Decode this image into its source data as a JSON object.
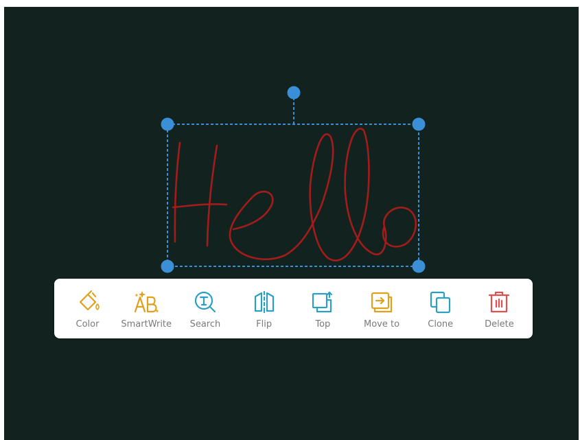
{
  "canvas": {
    "background": "#12231f",
    "ink_color": "#a31b1b",
    "selection_color": "#3a8fd6",
    "handwriting_text": "Hello"
  },
  "toolbar": {
    "items": [
      {
        "label": "Color",
        "icon": "paint-bucket-icon",
        "color": "#e0a01a"
      },
      {
        "label": "SmartWrite",
        "icon": "smartwrite-ab-icon",
        "color": "#e0a01a"
      },
      {
        "label": "Search",
        "icon": "text-search-icon",
        "color": "#2a9fc2"
      },
      {
        "label": "Flip",
        "icon": "flip-icon",
        "color": "#2a9fc2"
      },
      {
        "label": "Top",
        "icon": "bring-to-top-icon",
        "color": "#2a9fc2"
      },
      {
        "label": "Move to",
        "icon": "move-to-icon",
        "color": "#e0a01a"
      },
      {
        "label": "Clone",
        "icon": "clone-icon",
        "color": "#2a9fc2"
      },
      {
        "label": "Delete",
        "icon": "trash-icon",
        "color": "#e05050"
      }
    ]
  }
}
